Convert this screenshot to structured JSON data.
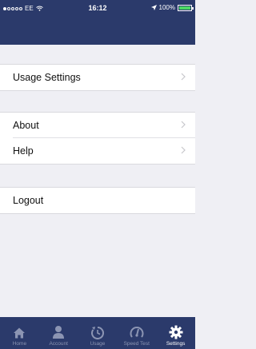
{
  "status_bar": {
    "carrier": "EE",
    "time": "16:12",
    "battery": "100%",
    "battery_level": 1.0
  },
  "settings": {
    "sections": [
      {
        "items": [
          {
            "label": "Usage Settings"
          }
        ]
      },
      {
        "items": [
          {
            "label": "About"
          },
          {
            "label": "Help"
          }
        ]
      },
      {
        "items": [
          {
            "label": "Logout"
          }
        ]
      }
    ]
  },
  "tab_bar": {
    "tabs": [
      {
        "label": "Home",
        "icon": "home-icon",
        "active": false
      },
      {
        "label": "Account",
        "icon": "account-icon",
        "active": false
      },
      {
        "label": "Usage",
        "icon": "usage-icon",
        "active": false
      },
      {
        "label": "Speed Test",
        "icon": "speed-test-icon",
        "active": false
      },
      {
        "label": "Settings",
        "icon": "gear-icon",
        "active": true
      }
    ]
  },
  "colors": {
    "nav": "#2b3a6b",
    "background": "#efeff4",
    "tab_inactive": "#8c95b3",
    "tab_active": "#ffffff"
  }
}
